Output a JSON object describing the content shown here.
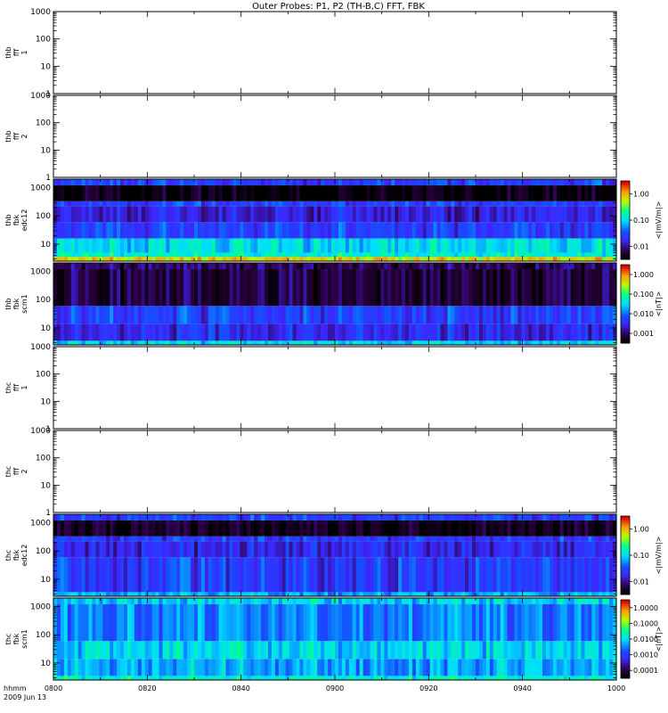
{
  "title": "Outer Probes: P1, P2 (TH-B,C) FFT, FBK",
  "x_axis": {
    "label_line1": "hhmm",
    "label_line2": "2009 Jun 13",
    "ticks": [
      "0800",
      "0820",
      "0840",
      "0900",
      "0920",
      "0940",
      "1000"
    ]
  },
  "chart_data": [
    {
      "type": "heatmap",
      "ylabel": [
        "thb",
        "fff",
        "1"
      ],
      "yscale": "log",
      "ylim": [
        1,
        1000
      ],
      "yticks": [
        "1",
        "10",
        "100",
        "1000"
      ],
      "has_data": false
    },
    {
      "type": "heatmap",
      "ylabel": [
        "thb",
        "fff",
        "2"
      ],
      "yscale": "log",
      "ylim": [
        1,
        1000
      ],
      "yticks": [
        "1",
        "10",
        "100",
        "1000"
      ],
      "has_data": false
    },
    {
      "type": "heatmap",
      "ylabel": [
        "thb",
        "fbk",
        "edc12"
      ],
      "yscale": "log",
      "ylim": [
        2.5,
        2000
      ],
      "yticks": [
        "10",
        "100",
        "1000"
      ],
      "has_data": true,
      "bands": [
        {
          "f_lo": 2.5,
          "f_hi": 3.5,
          "level": 0.8
        },
        {
          "f_lo": 3.5,
          "f_hi": 5,
          "level": 0.55
        },
        {
          "f_lo": 5,
          "f_hi": 16,
          "level": 0.5
        },
        {
          "f_lo": 16,
          "f_hi": 60,
          "level": 0.3
        },
        {
          "f_lo": 60,
          "f_hi": 220,
          "level": 0.22
        },
        {
          "f_lo": 220,
          "f_hi": 330,
          "level": 0.3
        },
        {
          "f_lo": 330,
          "f_hi": 1200,
          "level": 0.0
        },
        {
          "f_lo": 1200,
          "f_hi": 2000,
          "level": 0.3
        }
      ],
      "colorbar": {
        "label": "<|mV/m|>",
        "ticks": [
          "0.01",
          "0.10",
          "1.00"
        ]
      }
    },
    {
      "type": "heatmap",
      "ylabel": [
        "thb",
        "fbk",
        "scm1"
      ],
      "yscale": "log",
      "ylim": [
        2.5,
        2000
      ],
      "yticks": [
        "10",
        "100",
        "1000"
      ],
      "has_data": true,
      "bands": [
        {
          "f_lo": 2.5,
          "f_hi": 3.5,
          "level": 0.5
        },
        {
          "f_lo": 3.5,
          "f_hi": 14,
          "level": 0.25
        },
        {
          "f_lo": 14,
          "f_hi": 60,
          "level": 0.3
        },
        {
          "f_lo": 60,
          "f_hi": 1200,
          "level": 0.08
        },
        {
          "f_lo": 1200,
          "f_hi": 2000,
          "level": 0.1
        }
      ],
      "colorbar": {
        "label": "<|nT|>",
        "ticks": [
          "0.001",
          "0.010",
          "0.100",
          "1.000"
        ]
      }
    },
    {
      "type": "heatmap",
      "ylabel": [
        "thc",
        "fff",
        "1"
      ],
      "yscale": "log",
      "ylim": [
        1,
        1000
      ],
      "yticks": [
        "1",
        "10",
        "100",
        "1000"
      ],
      "has_data": false
    },
    {
      "type": "heatmap",
      "ylabel": [
        "thc",
        "fff",
        "2"
      ],
      "yscale": "log",
      "ylim": [
        1,
        1000
      ],
      "yticks": [
        "1",
        "10",
        "100",
        "1000"
      ],
      "has_data": false
    },
    {
      "type": "heatmap",
      "ylabel": [
        "thc",
        "fbk",
        "edc12"
      ],
      "yscale": "log",
      "ylim": [
        2.5,
        2000
      ],
      "yticks": [
        "10",
        "100",
        "1000"
      ],
      "has_data": true,
      "bands": [
        {
          "f_lo": 2.5,
          "f_hi": 3.5,
          "level": 0.45
        },
        {
          "f_lo": 3.5,
          "f_hi": 60,
          "level": 0.3
        },
        {
          "f_lo": 60,
          "f_hi": 220,
          "level": 0.25
        },
        {
          "f_lo": 220,
          "f_hi": 330,
          "level": 0.3
        },
        {
          "f_lo": 330,
          "f_hi": 1200,
          "level": 0.05
        },
        {
          "f_lo": 1200,
          "f_hi": 2000,
          "level": 0.3
        }
      ],
      "colorbar": {
        "label": "<|mV/m|>",
        "ticks": [
          "0.01",
          "0.10",
          "1.00"
        ]
      }
    },
    {
      "type": "heatmap",
      "ylabel": [
        "thc",
        "fbk",
        "scm1"
      ],
      "yscale": "log",
      "ylim": [
        2.5,
        2000
      ],
      "yticks": [
        "10",
        "100",
        "1000"
      ],
      "has_data": true,
      "bands": [
        {
          "f_lo": 2.5,
          "f_hi": 3.5,
          "level": 0.55
        },
        {
          "f_lo": 3.5,
          "f_hi": 14,
          "level": 0.45
        },
        {
          "f_lo": 14,
          "f_hi": 60,
          "level": 0.5
        },
        {
          "f_lo": 60,
          "f_hi": 1200,
          "level": 0.4
        },
        {
          "f_lo": 1200,
          "f_hi": 2000,
          "level": 0.5
        }
      ],
      "colorbar": {
        "label": "<|nT|>",
        "ticks": [
          "0.0001",
          "0.0010",
          "0.0100",
          "0.1000",
          "1.0000"
        ]
      }
    }
  ]
}
